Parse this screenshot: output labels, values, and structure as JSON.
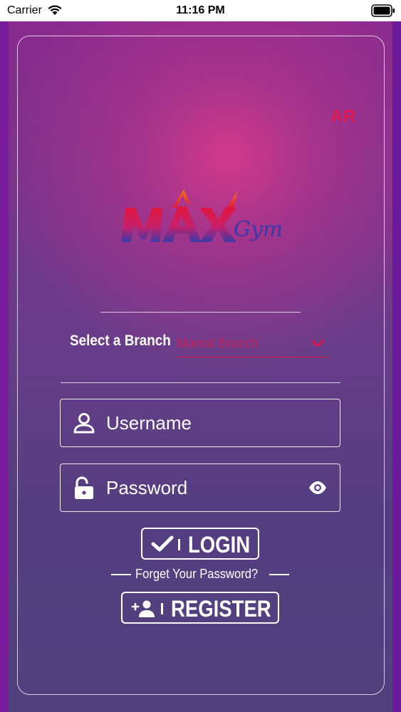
{
  "status_bar": {
    "carrier": "Carrier",
    "time": "11:16 PM"
  },
  "language_toggle": "AR",
  "logo": {
    "word_max": "MAX",
    "word_gym": "Gym",
    "colors": {
      "red": "#e0163e",
      "orange": "#f07a1a",
      "blue": "#3a3aa8"
    }
  },
  "branch": {
    "label": "Select a Branch",
    "selected": "Manial Branch"
  },
  "username": {
    "placeholder": "Username",
    "value": ""
  },
  "password": {
    "placeholder": "Password",
    "value": ""
  },
  "login_label": "LOGIN",
  "forgot_password": "Forget Your Password?",
  "register_label": "REGISTER",
  "colors": {
    "accent": "#e0164e",
    "background_top": "#8a2a8e",
    "background_bottom": "#52407e",
    "text": "#ffffff"
  },
  "icons": {
    "username": "person-icon",
    "password": "lock-open-icon",
    "visibility": "eye-icon",
    "login": "check-icon",
    "register": "add-user-icon"
  }
}
